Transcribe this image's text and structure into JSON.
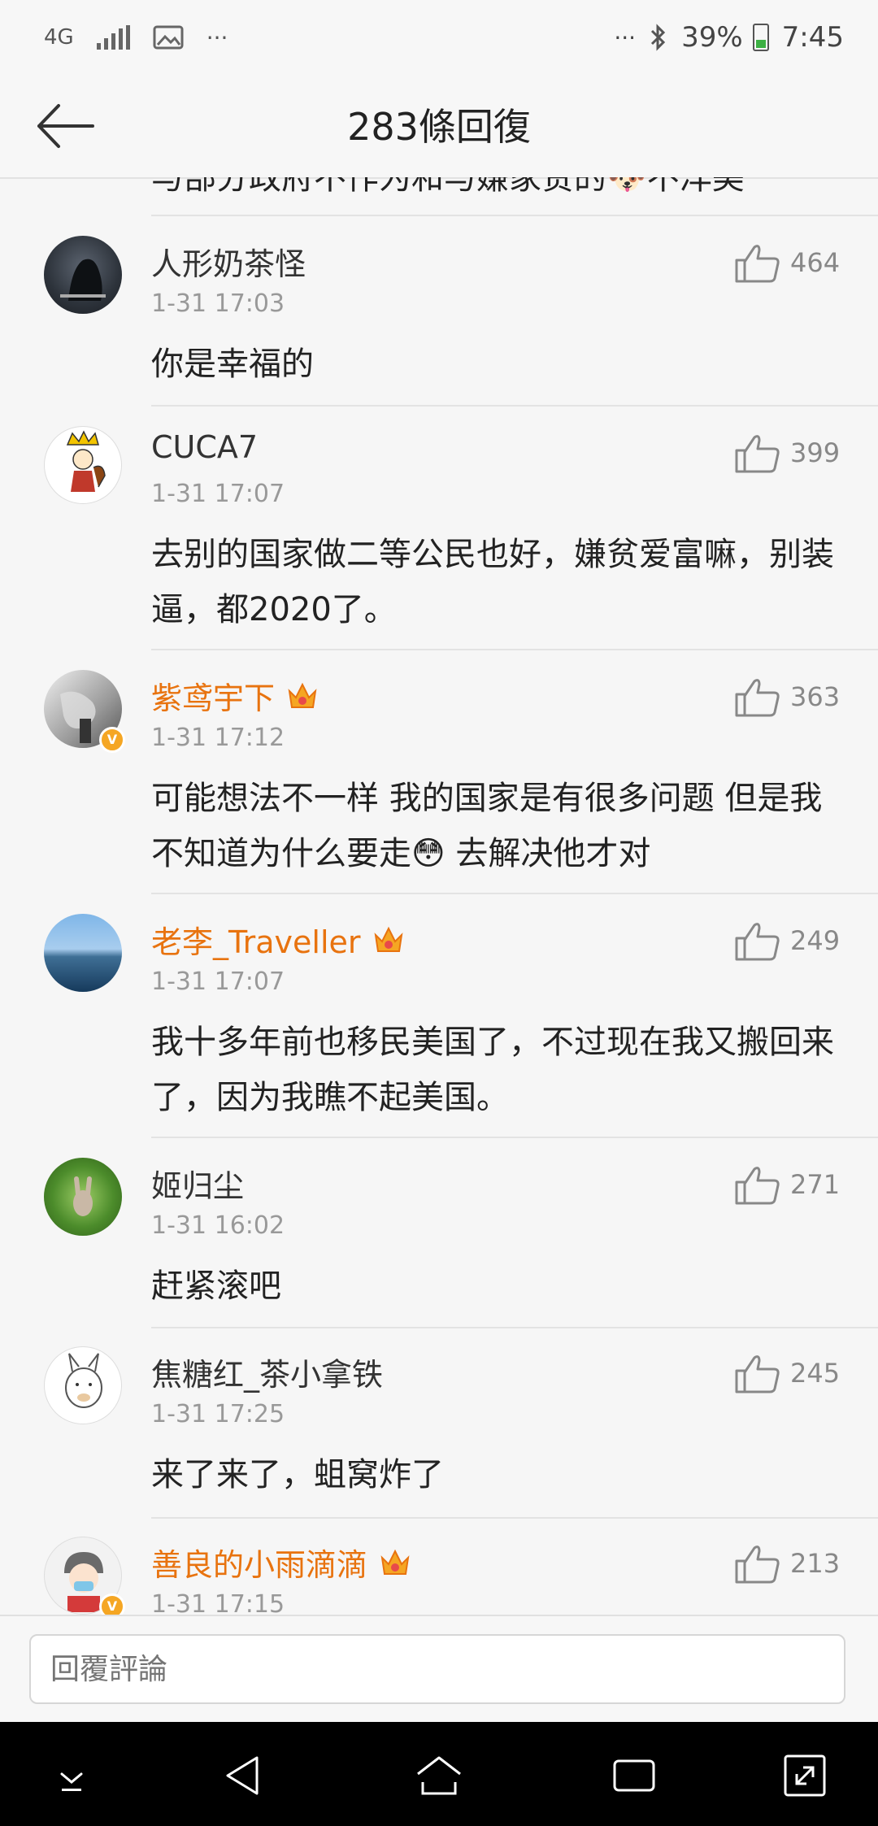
{
  "status_bar": {
    "network": "4G",
    "more": "···",
    "more_right": "···",
    "battery": "39%",
    "time": "7:45"
  },
  "header": {
    "title": "283條回復"
  },
  "partial_comment": {
    "text": "与部分政府不作为和与嫌家贫的🐶不洋美"
  },
  "comments": [
    {
      "username": "人形奶茶怪",
      "time": "1-31 17:03",
      "text": "你是幸福的",
      "likes": "464",
      "vip": false
    },
    {
      "username": "CUCA7",
      "time": "1-31 17:07",
      "text": "去别的国家做二等公民也好，嫌贫爱富嘛，别装逼，都2020了。",
      "likes": "399",
      "vip": false
    },
    {
      "username": "紫鸢宇下",
      "time": "1-31 17:12",
      "text": "可能想法不一样 我的国家是有很多问题 但是我不知道为什么要走😳 去解决他才对",
      "likes": "363",
      "vip": true
    },
    {
      "username": "老李_Traveller",
      "time": "1-31 17:07",
      "text": "我十多年前也移民美国了，不过现在我又搬回来了，因为我瞧不起美国。",
      "likes": "249",
      "vip": true
    },
    {
      "username": "姬归尘",
      "time": "1-31 16:02",
      "text": "赶紧滚吧",
      "likes": "271",
      "vip": false
    },
    {
      "username": "焦糖红_茶小拿铁",
      "time": "1-31 17:25",
      "text": "来了来了，蛆窝炸了",
      "likes": "245",
      "vip": false
    },
    {
      "username": "善良的小雨滴滴",
      "time": "1-31 17:15",
      "text": "",
      "likes": "213",
      "vip": true
    }
  ],
  "reply_bar": {
    "placeholder": "回覆評論"
  },
  "colors": {
    "vip_name": "#e8730f",
    "background": "#f6f6f6",
    "nav_background": "#000000"
  },
  "icons": [
    "back-arrow-icon",
    "like-icon",
    "crown-icon",
    "verified-badge-icon",
    "nav-down-icon",
    "nav-back-icon",
    "nav-home-icon",
    "nav-recents-icon",
    "nav-expand-icon"
  ]
}
